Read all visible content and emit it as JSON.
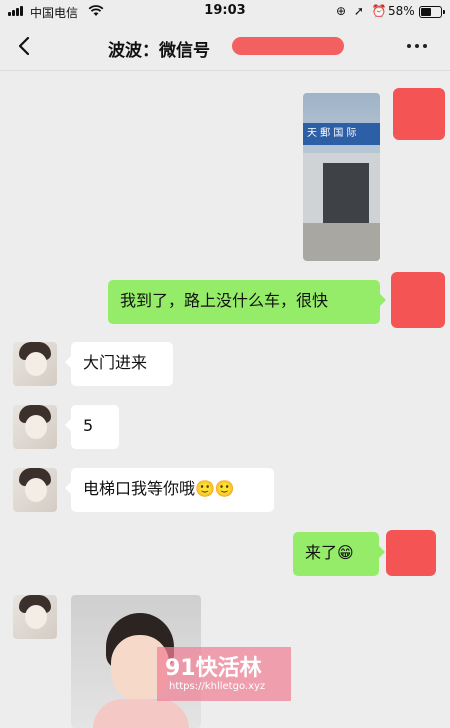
{
  "status": {
    "carrier": "中国电信",
    "time": "19:03",
    "icons": "⊕ ➚ ⏰",
    "battery": "58%",
    "battery_level": 0.58
  },
  "nav": {
    "title": "波波：微信号",
    "back_icon": "chevron-left-icon",
    "more_icon": "ellipsis-icon"
  },
  "messages": [
    {
      "side": "out",
      "type": "image",
      "sign_text": "天 郵 国 际"
    },
    {
      "side": "out",
      "type": "text",
      "text": "我到了，路上没什么车，很快"
    },
    {
      "side": "in",
      "type": "text",
      "text": "大门进来"
    },
    {
      "side": "in",
      "type": "text",
      "text": "5"
    },
    {
      "side": "in",
      "type": "text",
      "text": "电梯口我等你哦🙂🙂"
    },
    {
      "side": "out",
      "type": "text",
      "text": "来了😁"
    },
    {
      "side": "in",
      "type": "image"
    }
  ],
  "watermark": {
    "name": "91快活林",
    "url": "https://khlletgo.xyz"
  },
  "colors": {
    "background": "#ededed",
    "out_bubble": "#95ec69",
    "in_bubble": "#ffffff",
    "redaction": "#f45454"
  }
}
